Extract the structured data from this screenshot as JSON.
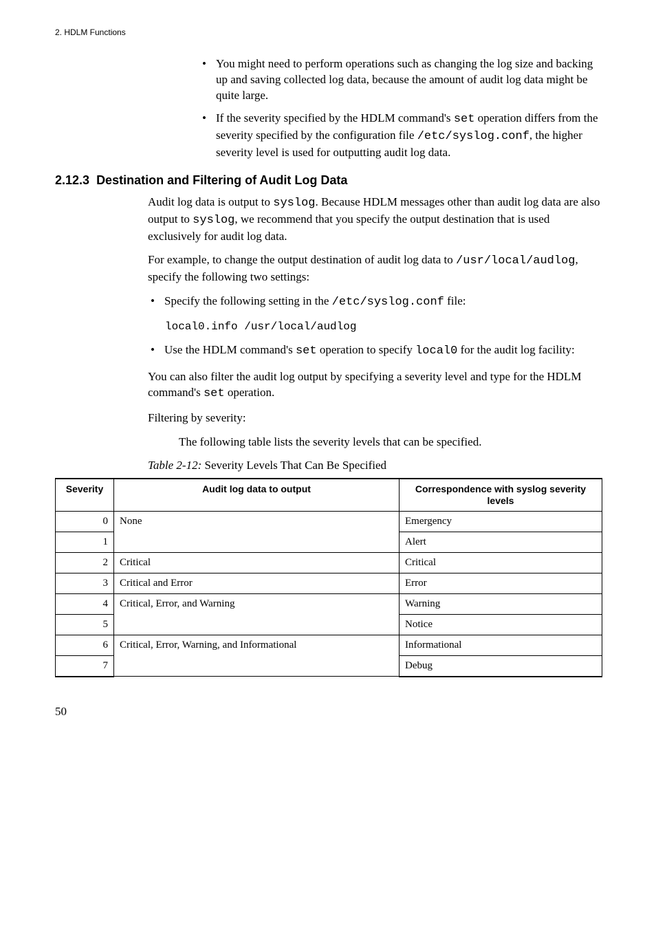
{
  "runningHead": "2. HDLM Functions",
  "topBullets": [
    {
      "pre": "You might need to perform operations such as changing the log size and backing up and saving collected log data, because the amount of audit log data might be quite large."
    },
    {
      "pre": "If the severity specified by the HDLM command's ",
      "code1": "set",
      "mid": " operation differs from the severity specified by the configuration file ",
      "code2": "/etc/syslog.conf",
      "post": ", the higher severity level is used for outputting audit log data."
    }
  ],
  "section": {
    "number": "2.12.3",
    "title": "Destination and Filtering of Audit Log Data"
  },
  "para1": {
    "pre": "Audit log data is output to ",
    "code1": "syslog",
    "mid": ". Because HDLM messages other than audit log data are also output to ",
    "code2": "syslog",
    "post": ", we recommend that you specify the output destination that is used exclusively for audit log data."
  },
  "para2": {
    "pre": "For example, to change the output destination of audit log data to ",
    "code1": "/usr/local/audlog",
    "post": ", specify the following two settings:"
  },
  "specBullets": [
    {
      "pre": "Specify the following setting in the ",
      "code1": "/etc/syslog.conf",
      "post": " file:"
    }
  ],
  "codeBlock": "local0.info /usr/local/audlog",
  "specBullets2": [
    {
      "pre": "Use the HDLM command's ",
      "code1": "set",
      "mid": " operation to specify ",
      "code2": "local0",
      "post": " for the audit log facility:"
    }
  ],
  "para3": {
    "pre": "You can also filter the audit log output by specifying a severity level and type for the HDLM command's ",
    "code1": "set",
    "post": " operation."
  },
  "para4": "Filtering by severity:",
  "para5": "The following table lists the severity levels that can be specified.",
  "tableCaption": {
    "lead": "Table  2-12:",
    "rest": "  Severity Levels That Can Be Specified"
  },
  "tableHeaders": {
    "c1": "Severity",
    "c2": "Audit log data to output",
    "c3": "Correspondence with syslog severity levels"
  },
  "rows": [
    {
      "sev": "0",
      "audit": "None",
      "auditRowspan": 2,
      "corr": "Emergency"
    },
    {
      "sev": "1",
      "corr": "Alert"
    },
    {
      "sev": "2",
      "audit": "Critical",
      "corr": "Critical"
    },
    {
      "sev": "3",
      "audit": "Critical and Error",
      "corr": "Error"
    },
    {
      "sev": "4",
      "audit": "Critical, Error, and Warning",
      "auditRowspan": 2,
      "corr": "Warning"
    },
    {
      "sev": "5",
      "corr": "Notice"
    },
    {
      "sev": "6",
      "audit": "Critical, Error, Warning, and Informational",
      "auditRowspan": 2,
      "corr": "Informational"
    },
    {
      "sev": "7",
      "corr": "Debug"
    }
  ],
  "pageNumber": "50"
}
